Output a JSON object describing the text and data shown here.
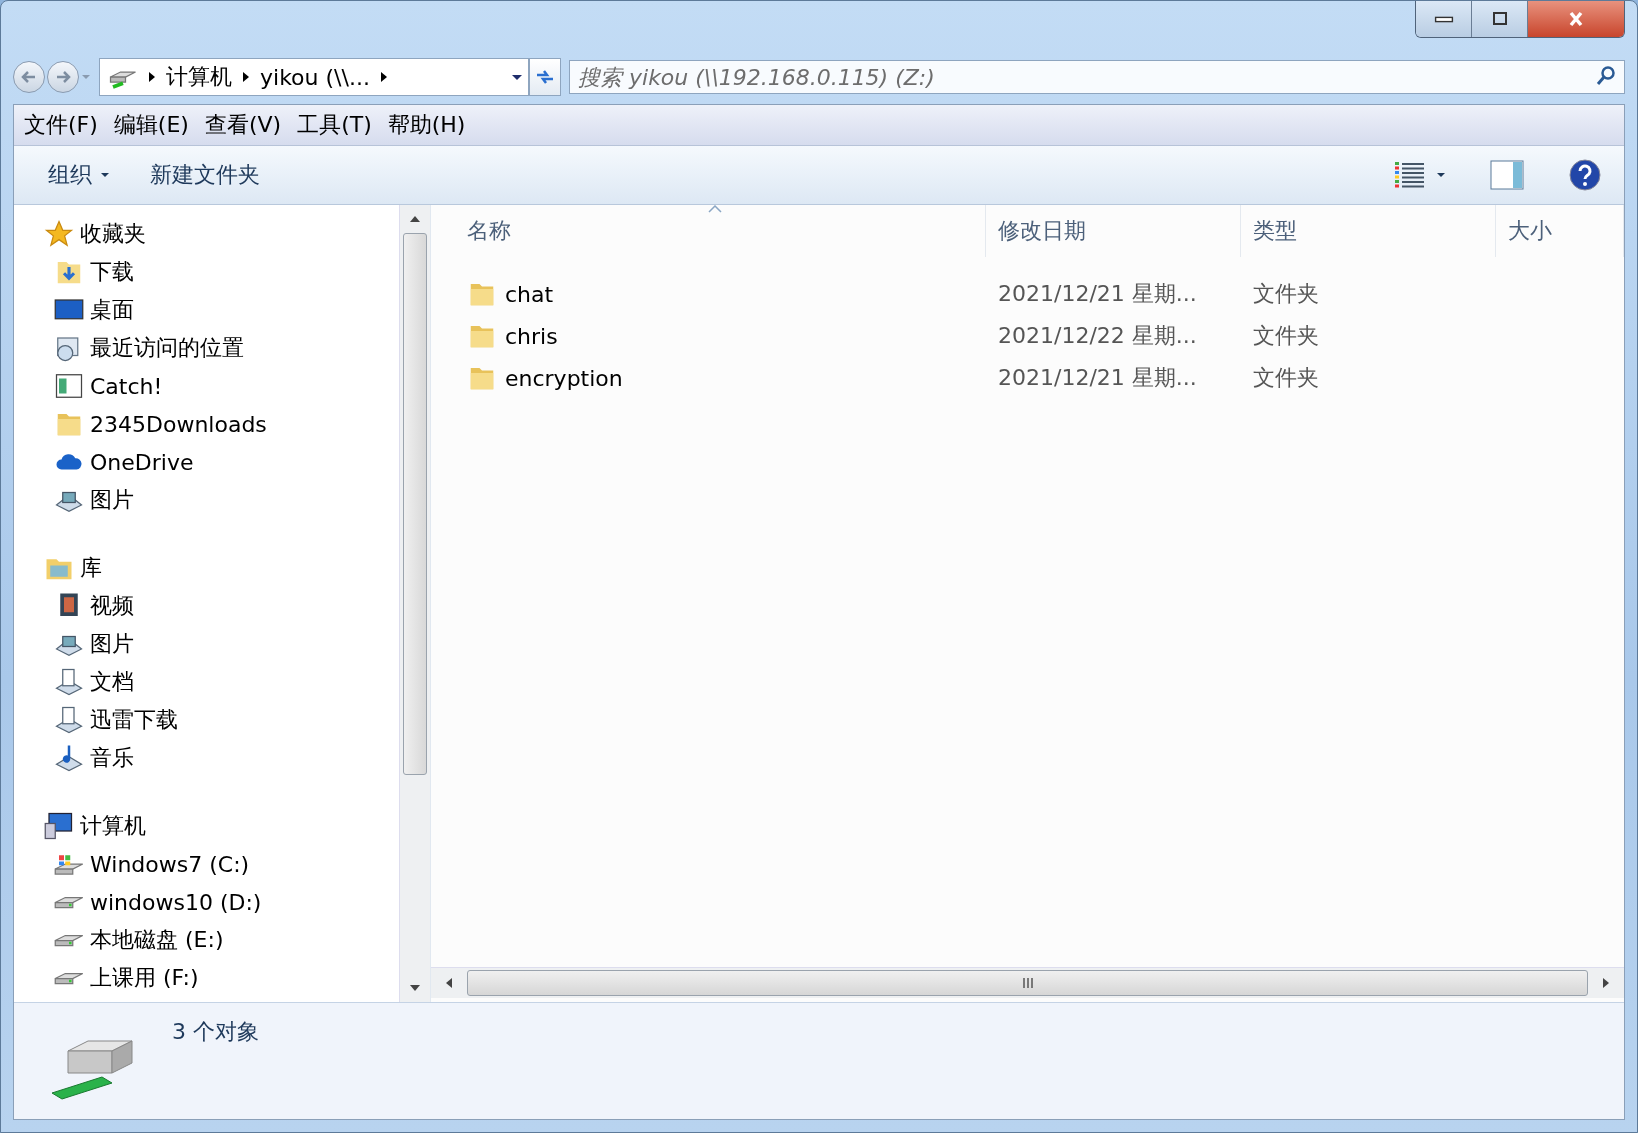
{
  "window": {
    "controls": [
      {
        "kind": "minimize"
      },
      {
        "kind": "maximize"
      },
      {
        "kind": "close"
      }
    ]
  },
  "address_bar": {
    "crumbs": [
      "计算机",
      "yikou (\\\\..."
    ]
  },
  "search": {
    "placeholder": "搜索 yikou (\\\\192.168.0.115) (Z:)"
  },
  "menu": [
    "文件(F)",
    "编辑(E)",
    "查看(V)",
    "工具(T)",
    "帮助(H)"
  ],
  "toolbar": {
    "organize": "组织",
    "new_folder": "新建文件夹"
  },
  "sidebar": {
    "sections": [
      {
        "label": "收藏夹",
        "kind": "star",
        "children": [
          {
            "label": "下载",
            "kind": "download"
          },
          {
            "label": "桌面",
            "kind": "desktop"
          },
          {
            "label": "最近访问的位置",
            "kind": "recent"
          },
          {
            "label": "Catch!",
            "kind": "app"
          },
          {
            "label": "2345Downloads",
            "kind": "folder"
          },
          {
            "label": "OneDrive",
            "kind": "cloud"
          },
          {
            "label": "图片",
            "kind": "pictures"
          }
        ]
      },
      {
        "label": "库",
        "kind": "library",
        "children": [
          {
            "label": "视频",
            "kind": "video"
          },
          {
            "label": "图片",
            "kind": "pictures"
          },
          {
            "label": "文档",
            "kind": "document"
          },
          {
            "label": "迅雷下载",
            "kind": "document"
          },
          {
            "label": "音乐",
            "kind": "music"
          }
        ]
      },
      {
        "label": "计算机",
        "kind": "computer",
        "children": [
          {
            "label": "Windows7 (C:)",
            "kind": "windrive"
          },
          {
            "label": "windows10 (D:)",
            "kind": "drive"
          },
          {
            "label": "本地磁盘 (E:)",
            "kind": "drive"
          },
          {
            "label": "上课用 (F:)",
            "kind": "drive"
          }
        ]
      }
    ]
  },
  "table": {
    "columns": [
      {
        "label": "名称",
        "sorted": true
      },
      {
        "label": "修改日期",
        "sorted": false
      },
      {
        "label": "类型",
        "sorted": false
      },
      {
        "label": "大小",
        "sorted": false
      }
    ],
    "rows": [
      {
        "name": "chat",
        "date": "2021/12/21 星期...",
        "type": "文件夹"
      },
      {
        "name": "chris",
        "date": "2021/12/22 星期...",
        "type": "文件夹"
      },
      {
        "name": "encryption",
        "date": "2021/12/21 星期...",
        "type": "文件夹"
      }
    ]
  },
  "status_bar": {
    "text": "3 个对象"
  }
}
